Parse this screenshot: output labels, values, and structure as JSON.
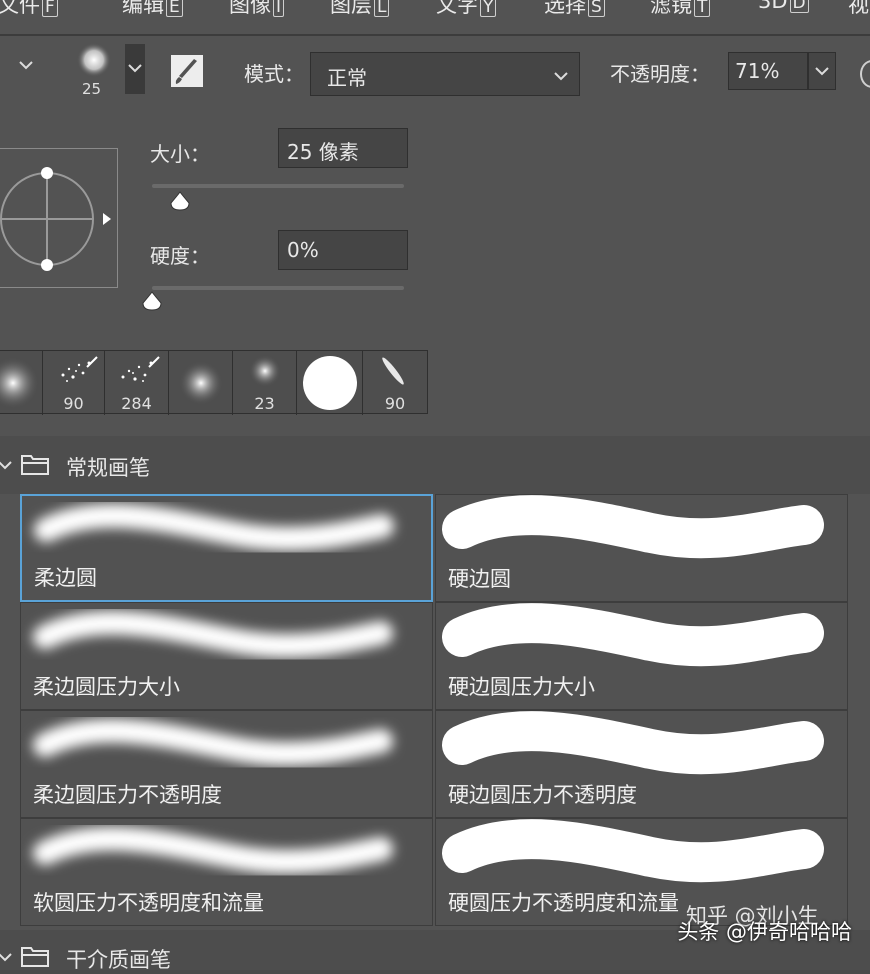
{
  "menubar": {
    "items": [
      {
        "label": "文件",
        "key": "F"
      },
      {
        "label": "编辑",
        "key": "E"
      },
      {
        "label": "图像",
        "key": "I"
      },
      {
        "label": "图层",
        "key": "L"
      },
      {
        "label": "文字",
        "key": "Y"
      },
      {
        "label": "选择",
        "key": "S"
      },
      {
        "label": "滤镜",
        "key": "T"
      },
      {
        "label": "3D",
        "key": "D"
      },
      {
        "label": "视",
        "key": ""
      }
    ]
  },
  "options": {
    "brush_size_value": "25",
    "mode_label": "模式：",
    "mode_value": "正常",
    "opacity_label": "不透明度：",
    "opacity_value": "71%"
  },
  "brush_panel": {
    "size_label": "大小：",
    "size_value": "25 像素",
    "size_fraction": 0.11,
    "hardness_label": "硬度：",
    "hardness_value": "0%",
    "hardness_fraction": 0.0,
    "recent_presets": [
      "",
      "90",
      "284",
      "",
      "23",
      "",
      "90"
    ],
    "folder_general": "常规画笔",
    "brushes": [
      {
        "name": "柔边圆",
        "type": "soft"
      },
      {
        "name": "硬边圆",
        "type": "hard"
      },
      {
        "name": "柔边圆压力大小",
        "type": "soft"
      },
      {
        "name": "硬边圆压力大小",
        "type": "hard"
      },
      {
        "name": "柔边圆压力不透明度",
        "type": "soft"
      },
      {
        "name": "硬边圆压力不透明度",
        "type": "hard"
      },
      {
        "name": "软圆压力不透明度和流量",
        "type": "soft"
      },
      {
        "name": "硬圆压力不透明度和流量",
        "type": "hard"
      }
    ],
    "folder_next": "干介质画笔"
  },
  "watermark": "头条 @伊奇哈哈哈",
  "watermark_overlay": "知乎 @刘小生",
  "colors": {
    "selection": "#5aa3d8",
    "panel_bg": "#535353",
    "stroke": "#ffffff"
  }
}
